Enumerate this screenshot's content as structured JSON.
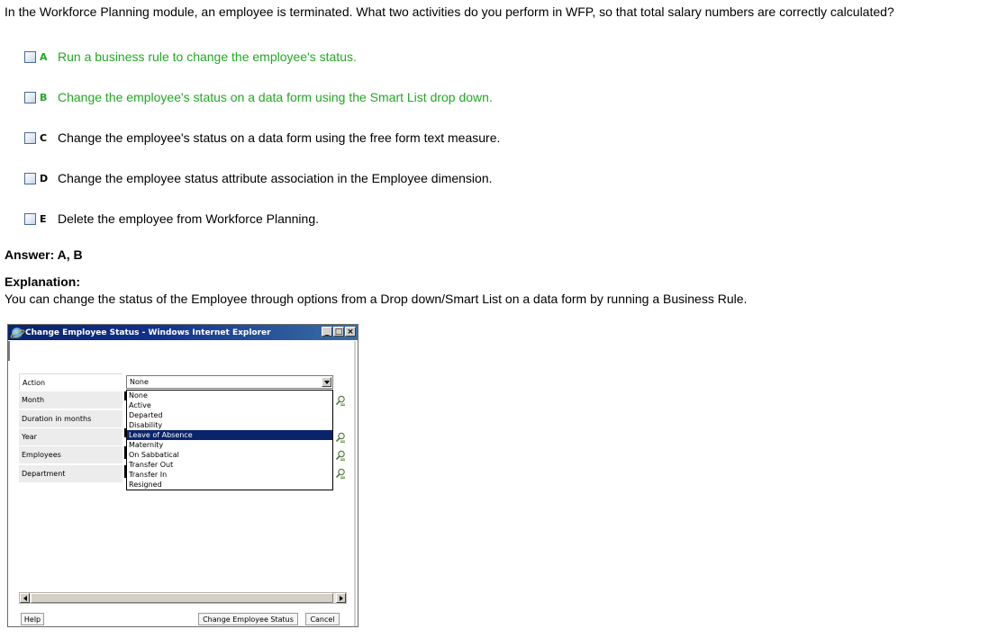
{
  "question": "In the Workforce Planning module, an employee is terminated. What two activities do you perform in WFP, so that total salary numbers are correctly calculated?",
  "options": [
    {
      "letter": "A",
      "text": "Run a business rule to change the employee's status."
    },
    {
      "letter": "B",
      "text": "Change the employee's status on a data form using the Smart List drop down."
    },
    {
      "letter": "C",
      "text": "Change the employee's status on a data form using the free form text measure."
    },
    {
      "letter": "D",
      "text": "Change the employee status attribute association in the Employee dimension."
    },
    {
      "letter": "E",
      "text": "Delete the employee from Workforce Planning."
    }
  ],
  "answer": "Answer: A, B",
  "explanation": {
    "heading": "Explanation:",
    "text": "You can change the status of the Employee through options from a Drop down/Smart List on a data form by running a Business Rule."
  },
  "colors": {
    "correct": "#22a822",
    "titlebar": "#0a246a",
    "highlight": "#0a246a"
  },
  "dialog": {
    "title": "Change Employee Status - Windows Internet Explorer",
    "window_buttons": [
      "minimize-icon",
      "maximize-icon",
      "close-icon"
    ],
    "labels": [
      "Action",
      "Month",
      "Duration in months",
      "Year",
      "Employees",
      "Department"
    ],
    "action_selected": "None",
    "dropdown_options": [
      "None",
      "Active",
      "Departed",
      "Disability",
      "Leave of Absence",
      "Maternity",
      "On Sabbatical",
      "Transfer Out",
      "Transfer In",
      "Resigned"
    ],
    "highlighted_option": "Leave of Absence",
    "buttons": {
      "help": "Help",
      "change": "Change Employee Status",
      "cancel": "Cancel"
    }
  }
}
